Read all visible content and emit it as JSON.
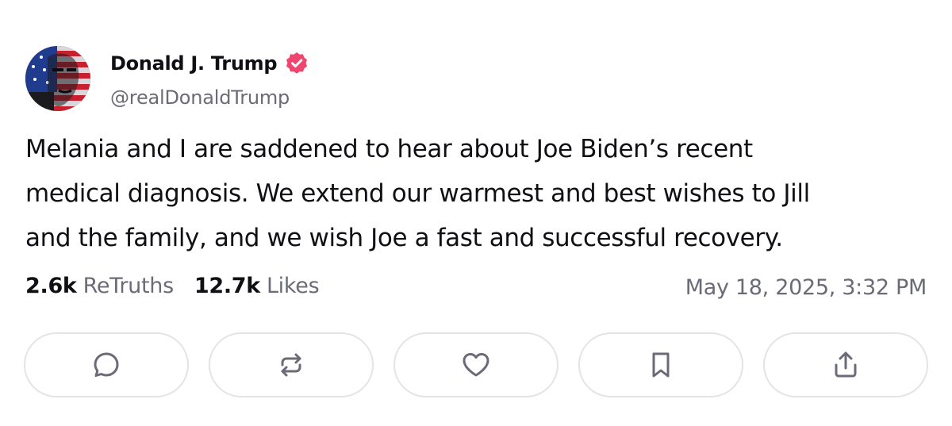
{
  "post": {
    "author_name": "Donald J. Trump",
    "handle": "@realDonaldTrump",
    "body_lines": [
      "Melania and I are saddened to hear about Joe Biden’s recent",
      "medical diagnosis. We extend our warmest and best wishes to Jill",
      "and the family, and we wish Joe a fast and successful recovery."
    ],
    "retruths_count": "2.6k",
    "retruths_label": "ReTruths",
    "likes_count": "12.7k",
    "likes_label": "Likes",
    "timestamp": "May 18, 2025, 3:32 PM"
  },
  "icons": {
    "avatar": "avatar",
    "verified": "verified-badge-icon",
    "reply": "reply-icon",
    "retruth": "retruth-icon",
    "like": "heart-icon",
    "bookmark": "bookmark-icon",
    "share": "share-icon"
  },
  "colors": {
    "verified": "#f0456e",
    "text": "#0f0f14",
    "muted": "#6b6b78",
    "border": "#e4e4e8"
  }
}
